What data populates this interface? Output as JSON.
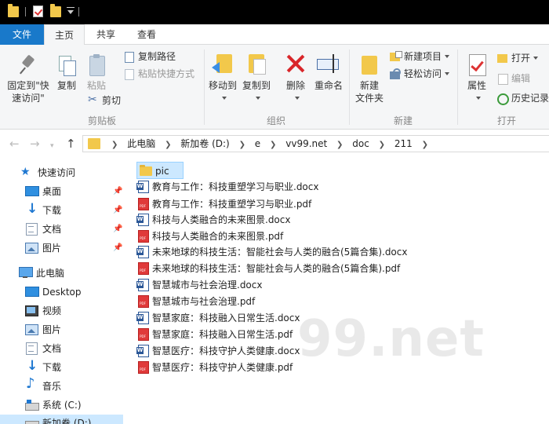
{
  "ribbon_tabs": {
    "file": "文件",
    "home": "主页",
    "share": "共享",
    "view": "查看"
  },
  "ribbon": {
    "clipboard": {
      "pin_quick_access_line1": "固定到\"快",
      "pin_quick_access_line2": "速访问\"",
      "copy": "复制",
      "paste": "粘贴",
      "copy_path": "复制路径",
      "paste_shortcut": "粘贴快捷方式",
      "cut": "剪切",
      "label": "剪贴板"
    },
    "organize": {
      "move_to": "移动到",
      "copy_to": "复制到",
      "delete": "删除",
      "rename": "重命名",
      "label": "组织"
    },
    "new": {
      "new_folder_line1": "新建",
      "new_folder_line2": "文件夹",
      "new_item": "新建项目",
      "easy_access": "轻松访问",
      "label": "新建"
    },
    "open": {
      "properties": "属性",
      "open": "打开",
      "edit": "编辑",
      "history": "历史记录",
      "label": "打开"
    }
  },
  "breadcrumb": [
    "此电脑",
    "新加卷 (D:)",
    "e",
    "vv99.net",
    "doc",
    "211"
  ],
  "sidebar": {
    "quick_access": "快速访问",
    "quick_items": [
      "桌面",
      "下载",
      "文档",
      "图片"
    ],
    "this_pc": "此电脑",
    "pc_items": [
      "Desktop",
      "视频",
      "图片",
      "文档",
      "下载",
      "音乐",
      "系统 (C:)",
      "新加卷 (D:)"
    ]
  },
  "files": [
    {
      "name": "pic",
      "type": "folder"
    },
    {
      "name": "教育与工作：科技重塑学习与职业.docx",
      "type": "docx"
    },
    {
      "name": "教育与工作：科技重塑学习与职业.pdf",
      "type": "pdf"
    },
    {
      "name": "科技与人类融合的未来图景.docx",
      "type": "docx"
    },
    {
      "name": "科技与人类融合的未来图景.pdf",
      "type": "pdf"
    },
    {
      "name": "未来地球的科技生活：智能社会与人类的融合(5篇合集).docx",
      "type": "docx"
    },
    {
      "name": "未来地球的科技生活：智能社会与人类的融合(5篇合集).pdf",
      "type": "pdf"
    },
    {
      "name": "智慧城市与社会治理.docx",
      "type": "docx"
    },
    {
      "name": "智慧城市与社会治理.pdf",
      "type": "pdf"
    },
    {
      "name": "智慧家庭：科技融入日常生活.docx",
      "type": "docx"
    },
    {
      "name": "智慧家庭：科技融入日常生活.pdf",
      "type": "pdf"
    },
    {
      "name": "智慧医疗：科技守护人类健康.docx",
      "type": "docx"
    },
    {
      "name": "智慧医疗：科技守护人类健康.pdf",
      "type": "pdf"
    }
  ],
  "watermark": "99.net",
  "colors": {
    "accent": "#1979ca",
    "selection": "#cce8ff",
    "folder": "#f2c84b",
    "pdf": "#e03a3a",
    "docx": "#2b5797"
  }
}
